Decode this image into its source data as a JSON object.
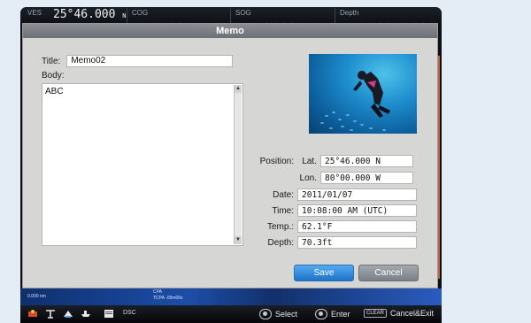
{
  "topbar": {
    "ves_label": "VES",
    "ves_value": "25°46.000",
    "ves_hemisphere": "N",
    "cog_label": "COG",
    "sog_label": "SOG",
    "depth_label": "Depth"
  },
  "dialog": {
    "title": "Memo",
    "title_label": "Title:",
    "title_value": "Memo02",
    "body_label": "Body:",
    "body_value": "ABC",
    "position_label": "Position:",
    "lat_label": "Lat.",
    "lat_value": "25°46.000 N",
    "lon_label": "Lon.",
    "lon_value": "80°00.000 W",
    "date_label": "Date:",
    "date_value": "2011/01/07",
    "time_label": "Time:",
    "time_value": "10:08:00 AM (UTC)",
    "temp_label": "Temp.:",
    "temp_value": "62.1°F",
    "depth_label": "Depth:",
    "depth_value": "70.3ft",
    "save_label": "Save",
    "cancel_label": "Cancel"
  },
  "mapstrip": {
    "range_text": "0.000 nm",
    "cpa_label": "CPA",
    "tcpa_label": "TCPA",
    "tcpa_value": "-09m00s"
  },
  "bottombar": {
    "dsc_label": "DSC",
    "select_label": "Select",
    "enter_label": "Enter",
    "clear_key": "CLEAR",
    "cancel_exit_label": "Cancel&Exit"
  },
  "colors": {
    "save_button": "#2a86dc",
    "cancel_button": "#8a8f94",
    "dialog_bg": "#d6d6d4",
    "title_bar": "#7b8085"
  }
}
